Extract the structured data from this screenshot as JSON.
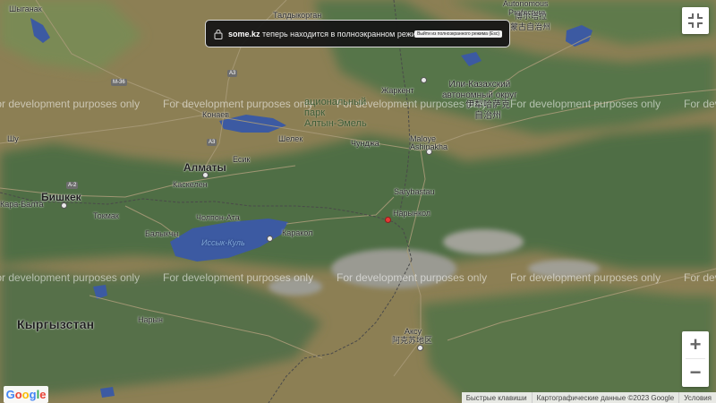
{
  "map": {
    "watermark": "For development purposes only",
    "labels": {
      "shyganak": "Шыганак",
      "taldykorgan": "Талдыкорган",
      "autonomous_en": "Autonomous",
      "prefecture_en": "Prefecture",
      "boertala_cn": "博尔塔拉",
      "mongol_cn": "蒙古自治州",
      "zharkent": "Жаркент",
      "ili_ru": "Или-Казахский\nавтономный округ",
      "ili_cn": "伊犁哈萨克\n自治州",
      "national_park": "ациональный\nпарк\nАлтын-Эмель",
      "konaev": "Конаев",
      "shu": "Шу",
      "shelek": "Шелек",
      "chundzha": "Чунджа",
      "maloye_ashinakha": "Maloye\nAshinakha",
      "esik": "Есик",
      "almaty": "Алматы",
      "kaskelen": "Каскелен",
      "bishkek": "Бишкек",
      "kara_balta": "Кара-Балта",
      "tokmak": "Токмак",
      "cholpon_ata": "Чолпон-Ата",
      "issyk_kul": "Иссык-Куль",
      "balykchy": "Балыкчы",
      "karakol": "Каракол",
      "sarybastau": "Sarybastau",
      "narynkol": "Нарынкол",
      "kyrgyzstan": "Кыргызстан",
      "naryn": "Нарын",
      "aksu_ru": "Аксу",
      "aksu_cn": "阿克苏地区",
      "road_m36": "M-36",
      "road_a3_1": "A3",
      "road_a3_2": "A3",
      "road_a2": "A-2"
    }
  },
  "fullscreen_notice": {
    "domain": "some.kz",
    "message": "теперь находится в полноэкранном режиме",
    "exit_label": "Выйти из полноэкранного режима (Esc)"
  },
  "controls": {
    "zoom_in": "+",
    "zoom_out": "−"
  },
  "logo": {
    "letters": [
      "G",
      "o",
      "o",
      "g",
      "l",
      "e"
    ],
    "colors": [
      "#4285F4",
      "#EA4335",
      "#FBBC05",
      "#4285F4",
      "#34A853",
      "#EA4335"
    ]
  },
  "attribution": {
    "shortcuts": "Быстрые клавиши",
    "map_data": "Картографические данные ©2023 Google",
    "terms": "Условия"
  },
  "colors": {
    "marker": "#e53935",
    "notice_bg": "#161616"
  }
}
